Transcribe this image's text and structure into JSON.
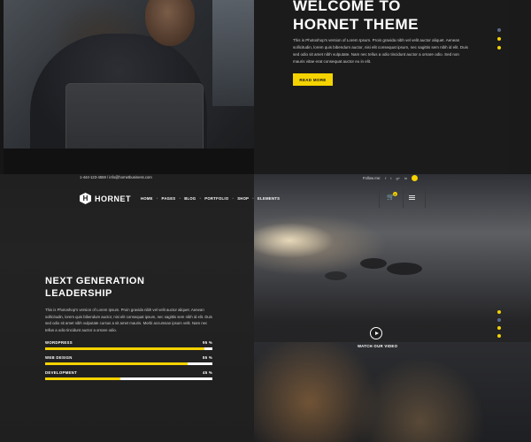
{
  "top": {
    "title_line1": "WELCOME TO",
    "title_line2": "HORNET THEME",
    "body": "This is Photoshop's version of Lorem Ipsum. Proin gravida nibh vel velit auctor aliquet. Aenean sollicitudin, lorem quis bibendum auctor, nisi elit consequat ipsum, nec sagittis sem nibh id elit. Duis sed odio sit amet nibh vulputate. Nam nec tellus a odio tincidunt auctor a ornare odio. Sed non mauris vitae erat consequat auctor eu in elit.",
    "cta_label": "READ MORE"
  },
  "header": {
    "contact": "1-444-123-4559 / info@hornetbusiness.com",
    "follow_label": "Follow me:",
    "socials": [
      "f",
      "t",
      "g+",
      "in"
    ],
    "logo_mark": "H",
    "logo_text": "HORNET",
    "nav": [
      "HOME",
      "PAGES",
      "BLOG",
      "PORTFOLIO",
      "SHOP",
      "ELEMENTS"
    ],
    "cart_count": "0"
  },
  "content": {
    "title_line1": "NEXT GENERATION",
    "title_line2": "LEADERSHIP",
    "body": "This is Photoshop's version of Lorem Ipsum. Proin gravida nibh vel velit auctor aliquet. Aenean sollicitudin, lorem quis bibendum auctor, nisi elit consequat ipsum, nec sagittis sem nibh id elit. Duis sed odio sit amet nibh vulputate cursus a sit amet mauris. Morbi accumsan ipsum velit. Nam nec tellus a odio tincidunt auctor a ornare odio.",
    "skills": [
      {
        "label": "WORDPRESS",
        "value": "95 %",
        "percent": 95
      },
      {
        "label": "WEB DESIGN",
        "value": "85 %",
        "percent": 85
      },
      {
        "label": "DEVELOPMENT",
        "value": "45 %",
        "percent": 45
      }
    ]
  },
  "video": {
    "label": "WATCH OUR VIDEO"
  },
  "colors": {
    "accent": "#f5d300",
    "dark": "#1a1a1a"
  }
}
